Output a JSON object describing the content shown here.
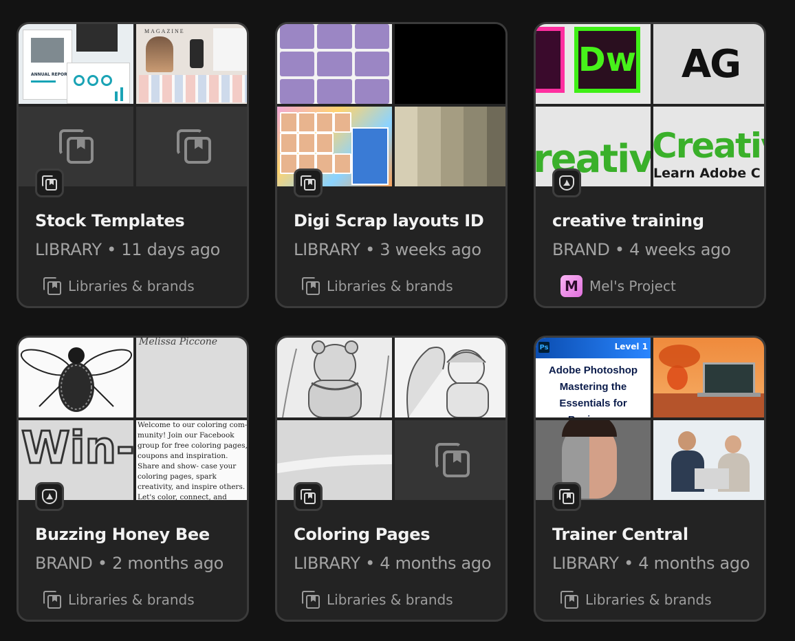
{
  "cards": [
    {
      "title": "Stock Templates",
      "type": "LIBRARY",
      "age": "11 days ago",
      "location": "Libraries & brands",
      "icon": "library-icon",
      "thumb_text": {
        "magazine": "MAGAZINE",
        "report": "ANNUAL REPORT"
      }
    },
    {
      "title": "Digi Scrap layouts ID",
      "type": "LIBRARY",
      "age": "3 weeks ago",
      "location": "Libraries & brands",
      "icon": "library-icon"
    },
    {
      "title": "creative training",
      "type": "BRAND",
      "age": "4 weeks ago",
      "location": "Mel's Project",
      "icon": "brand-icon",
      "avatar_letter": "M",
      "thumb_text": {
        "dw": "Dw",
        "ag": "AG",
        "creative1": "reative",
        "creative2": "Creative",
        "learn": "Learn Adobe C"
      }
    },
    {
      "title": "Buzzing Honey Bee",
      "type": "BRAND",
      "age": "2 months ago",
      "location": "Libraries & brands",
      "icon": "brand-icon",
      "thumb_text": {
        "signature": "Melissa Piccone",
        "win": "Win-",
        "paragraph": "Welcome to our coloring com- munity! Join our Facebook group for free coloring pages, coupons and inspiration. Share and show- case your coloring pages, spark creativity, and inspire others. Let's color, connect, and create together!"
      }
    },
    {
      "title": "Coloring Pages",
      "type": "LIBRARY",
      "age": "4 months ago",
      "location": "Libraries & brands",
      "icon": "library-icon"
    },
    {
      "title": "Trainer Central",
      "type": "LIBRARY",
      "age": "4 months ago",
      "location": "Libraries & brands",
      "icon": "library-icon",
      "thumb_text": {
        "ps": "Ps",
        "level": "Level 1",
        "course": "Adobe Photoshop Mastering the Essentials for Beginners"
      }
    }
  ],
  "separator": "•",
  "colors": {
    "background": "#131313",
    "card": "#232323",
    "card_border": "#3b3b3b",
    "title": "#f2f2f2",
    "meta": "#a3a3a3"
  }
}
